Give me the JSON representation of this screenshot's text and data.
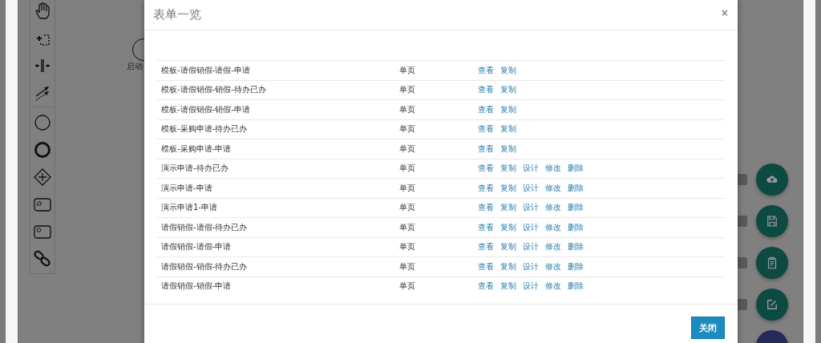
{
  "canvas": {
    "start_event_label": "启动"
  },
  "dialog": {
    "title": "表单一览",
    "close": "×",
    "rows": [
      {
        "name": "模板-请假销假-请假-申请",
        "type": "单页",
        "actions": [
          "查看",
          "复制"
        ]
      },
      {
        "name": "模板-请假销假-销假-待办已办",
        "type": "单页",
        "actions": [
          "查看",
          "复制"
        ]
      },
      {
        "name": "模板-请假销假-销假-申请",
        "type": "单页",
        "actions": [
          "查看",
          "复制"
        ]
      },
      {
        "name": "模板-采购申请-待办已办",
        "type": "单页",
        "actions": [
          "查看",
          "复制"
        ]
      },
      {
        "name": "模板-采购申请-申请",
        "type": "单页",
        "actions": [
          "查看",
          "复制"
        ]
      },
      {
        "name": "演示申请-待办已办",
        "type": "单页",
        "actions": [
          "查看",
          "复制",
          "设计",
          "修改",
          "删除"
        ]
      },
      {
        "name": "演示申请-申请",
        "type": "单页",
        "actions": [
          "查看",
          "复制",
          "设计",
          "修改",
          "删除"
        ]
      },
      {
        "name": "演示申请1-申请",
        "type": "单页",
        "actions": [
          "查看",
          "复制",
          "设计",
          "修改",
          "删除"
        ]
      },
      {
        "name": "请假销假-请假-待办已办",
        "type": "单页",
        "actions": [
          "查看",
          "复制",
          "设计",
          "修改",
          "删除"
        ]
      },
      {
        "name": "请假销假-请假-申请",
        "type": "单页",
        "actions": [
          "查看",
          "复制",
          "设计",
          "修改",
          "删除"
        ]
      },
      {
        "name": "请假销假-销假-待办已办",
        "type": "单页",
        "actions": [
          "查看",
          "复制",
          "设计",
          "修改",
          "删除"
        ]
      },
      {
        "name": "请假销假-销假-申请",
        "type": "单页",
        "actions": [
          "查看",
          "复制",
          "设计",
          "修改",
          "删除"
        ]
      }
    ],
    "buttons": [
      "关闭"
    ]
  }
}
